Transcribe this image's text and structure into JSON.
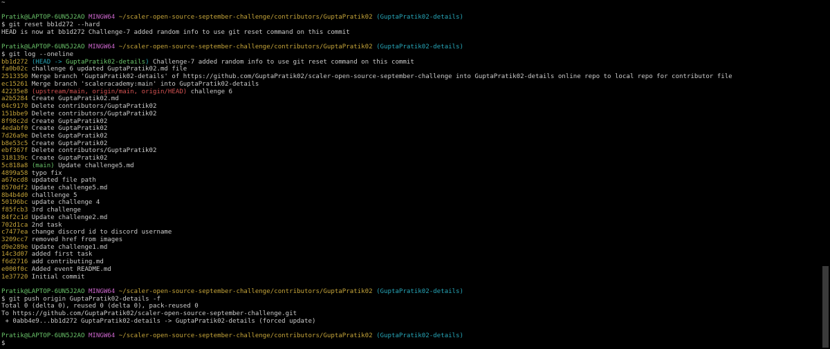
{
  "terminal": {
    "prompt": {
      "user_host": "Pratik@LAPTOP-6UN5J2AO",
      "system": "MINGW64",
      "path": "~/scaler-open-source-september-challenge/contributors/GuptaPratik02",
      "branch": "(GuptaPratik02-details)",
      "symbol": "$"
    },
    "top_tilde": "~",
    "cmd1": "git reset bb1d272 --hard",
    "cmd1_output": "HEAD is now at bb1d272 Challenge-7 added random info to use git reset command on this commit",
    "cmd2": "git log --oneline",
    "log": [
      {
        "hash": "bb1d272",
        "refs_open": "(",
        "ref_head": "HEAD -> ",
        "ref_cur": "GuptaPratik02-details",
        "refs_close": ")",
        "msg": " Challenge-7 added random info to use git reset command on this commit"
      },
      {
        "hash": "fa0b02c",
        "msg": " challenge 6 updated GuptaPratik02.md file"
      },
      {
        "hash": "2513350",
        "msg": " Merge branch 'GuptaPratik02-details' of https://github.com/GuptaPratik02/scaler-open-source-september-challenge into GuptaPratik02-details online repo to local repo for contributor file"
      },
      {
        "hash": "ec15261",
        "msg": " Merge branch 'scaleracademy:main' into GuptaPratik02-details"
      },
      {
        "hash": "42235e8",
        "refs_remote": "(upstream/main, origin/main, origin/HEAD)",
        "msg": " challenge 6"
      },
      {
        "hash": "a2b5284",
        "msg": " Create GuptaPratik02.md"
      },
      {
        "hash": "04c9170",
        "msg": " Delete contributors/GuptaPratik02"
      },
      {
        "hash": "151bbe9",
        "msg": " Delete contributors/GuptaPratik02"
      },
      {
        "hash": "8f98c2d",
        "msg": " Create GuptaPratik02"
      },
      {
        "hash": "4edabf0",
        "msg": " Create GuptaPratik02"
      },
      {
        "hash": "7d26a9e",
        "msg": " Delete GuptaPratik02"
      },
      {
        "hash": "b8e53c5",
        "msg": " Create GuptaPratik02"
      },
      {
        "hash": "ebf367f",
        "msg": " Delete contributors/GuptaPratik02"
      },
      {
        "hash": "318139c",
        "msg": " Create GuptaPratik02"
      },
      {
        "hash": "5c818a8",
        "refs_main": "(main)",
        "msg": " Update challenge5.md"
      },
      {
        "hash": "4899a58",
        "msg": " typo fix"
      },
      {
        "hash": "a67ecd8",
        "msg": " updated file path"
      },
      {
        "hash": "8570df2",
        "msg": " Update challenge5.md"
      },
      {
        "hash": "8b4b4d0",
        "msg": " challlenge 5"
      },
      {
        "hash": "50196bc",
        "msg": " update challenge 4"
      },
      {
        "hash": "f85fcb3",
        "msg": " 3rd challenge"
      },
      {
        "hash": "84f2c1d",
        "msg": " Update challenge2.md"
      },
      {
        "hash": "702d1ca",
        "msg": " 2nd task"
      },
      {
        "hash": "c7477ea",
        "msg": " change discord id to discord username"
      },
      {
        "hash": "3209cc7",
        "msg": " removed href from images"
      },
      {
        "hash": "d9e289e",
        "msg": " Update challenge1.md"
      },
      {
        "hash": "14c3d07",
        "msg": " added first task"
      },
      {
        "hash": "f6d2716",
        "msg": " add contributing.md"
      },
      {
        "hash": "e000f0c",
        "msg": " Added event README.md"
      },
      {
        "hash": "1e37720",
        "msg": " Initial commit"
      }
    ],
    "cmd3": "git push origin GuptaPratik02-details -f",
    "cmd3_output": [
      "Total 0 (delta 0), reused 0 (delta 0), pack-reused 0",
      "To https://github.com/GuptaPratik02/scaler-open-source-september-challenge.git",
      " + 0abb4e9...bb1d272 GuptaPratik02-details -> GuptaPratik02-details (forced update)"
    ]
  },
  "colors": {
    "background": "#000000",
    "text": "#cccccc",
    "user_host": "#6ac46a",
    "system": "#cc66cc",
    "path": "#c6a53a",
    "branch": "#27a6b8",
    "remote_refs": "#d65353"
  }
}
